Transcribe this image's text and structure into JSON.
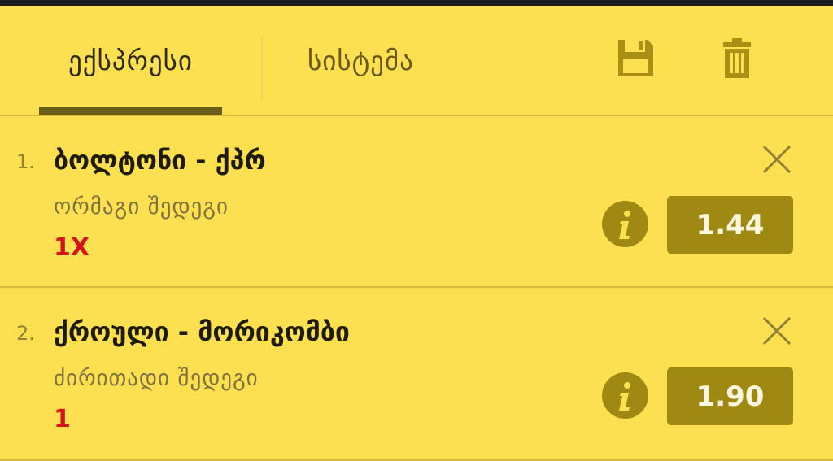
{
  "tabs": [
    {
      "label": "ექსპრესი",
      "active": true
    },
    {
      "label": "სისტემა",
      "active": false
    }
  ],
  "toolbar": {
    "save_icon": "save-icon",
    "trash_icon": "trash-icon"
  },
  "bets": [
    {
      "index": "1.",
      "match": "ბოლტონი - ქპრ",
      "market": "ორმაგი შედეგი",
      "pick": "1X",
      "odds": "1.44"
    },
    {
      "index": "2.",
      "match": "ქროული - მორიკომბი",
      "market": "ძირითადი შედეგი",
      "pick": "1",
      "odds": "1.90"
    }
  ],
  "colors": {
    "background": "#fde050",
    "accent": "#a08913",
    "pick": "#d3131f"
  }
}
